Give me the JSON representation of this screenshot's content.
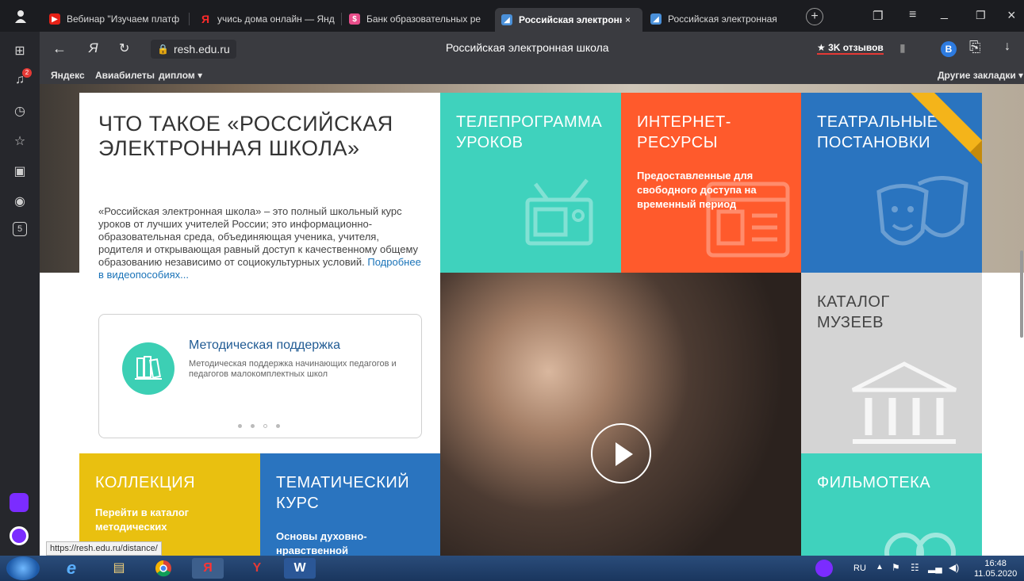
{
  "tabs": [
    {
      "label": "Вебинар \"Изучаем платф",
      "icon": "youtube-icon",
      "color": "#e62117"
    },
    {
      "label": "учись дома онлайн — Янд",
      "icon": "yandex-icon",
      "color": "#ff2b2b"
    },
    {
      "label": "Банк образовательных ре",
      "icon": "bank-icon",
      "color": "#e84d8a"
    },
    {
      "label": "Российская электронна",
      "icon": "resh-icon",
      "color": "#4a90d9",
      "active": true
    },
    {
      "label": "Российская электронная",
      "icon": "resh-icon",
      "color": "#4a90d9"
    }
  ],
  "addressbar": {
    "url": "resh.edu.ru",
    "page_title": "Российская электронная школа",
    "reviews": "★ 3K отзывов",
    "profile_letter": "B"
  },
  "bookmarks": {
    "items": [
      "Яндекс",
      "Авиабилеты",
      "диплом ▾"
    ],
    "other": "Другие закладки ▾"
  },
  "sidebar": {
    "badge_count": "2",
    "five_icon": "5"
  },
  "intro": {
    "title": "ЧТО ТАКОЕ «РОССИЙСКАЯ ЭЛЕКТРОННАЯ ШКОЛА»",
    "text": "«Российская электронная школа» – это полный школьный курс уроков от лучших учителей России; это информационно-образовательная среда, объединяющая ученика, учителя, родителя и открывающая равный доступ к качественному общему образованию независимо от социокультурных условий.",
    "link": "Подробнее в видеопособиях..."
  },
  "method_card": {
    "title": "Методическая поддержка",
    "desc": "Методическая поддержка начинающих педагогов и педагогов малокомплектных школ"
  },
  "tiles": {
    "tv": {
      "title": "ТЕЛЕПРОГРАММА УРОКОВ",
      "color": "#3fd2bd"
    },
    "internet": {
      "title": "ИНТЕРНЕТ-РЕСУРСЫ",
      "sub": "Предоставленные для свободного доступа на временный период",
      "color": "#ff5a2c"
    },
    "theatre": {
      "title": "ТЕАТРАЛЬНЫЕ ПОСТАНОВКИ",
      "color": "#2a74bf"
    },
    "museums": {
      "title": "КАТАЛОГ МУЗЕЕВ",
      "color": "#d4d4d4"
    },
    "collection": {
      "title": "КОЛЛЕКЦИЯ",
      "sub": "Перейти в каталог методических",
      "color": "#e9c010"
    },
    "thematic": {
      "title": "ТЕМАТИЧЕСКИЙ КУРС",
      "sub": "Основы духовно-нравственной",
      "color": "#2a74bf"
    },
    "films": {
      "title": "ФИЛЬМОТЕКА",
      "color": "#3fd2bd"
    }
  },
  "status_url": "https://resh.edu.ru/distance/",
  "taskbar": {
    "lang": "RU",
    "time": "16:48",
    "date": "11.05.2020"
  }
}
